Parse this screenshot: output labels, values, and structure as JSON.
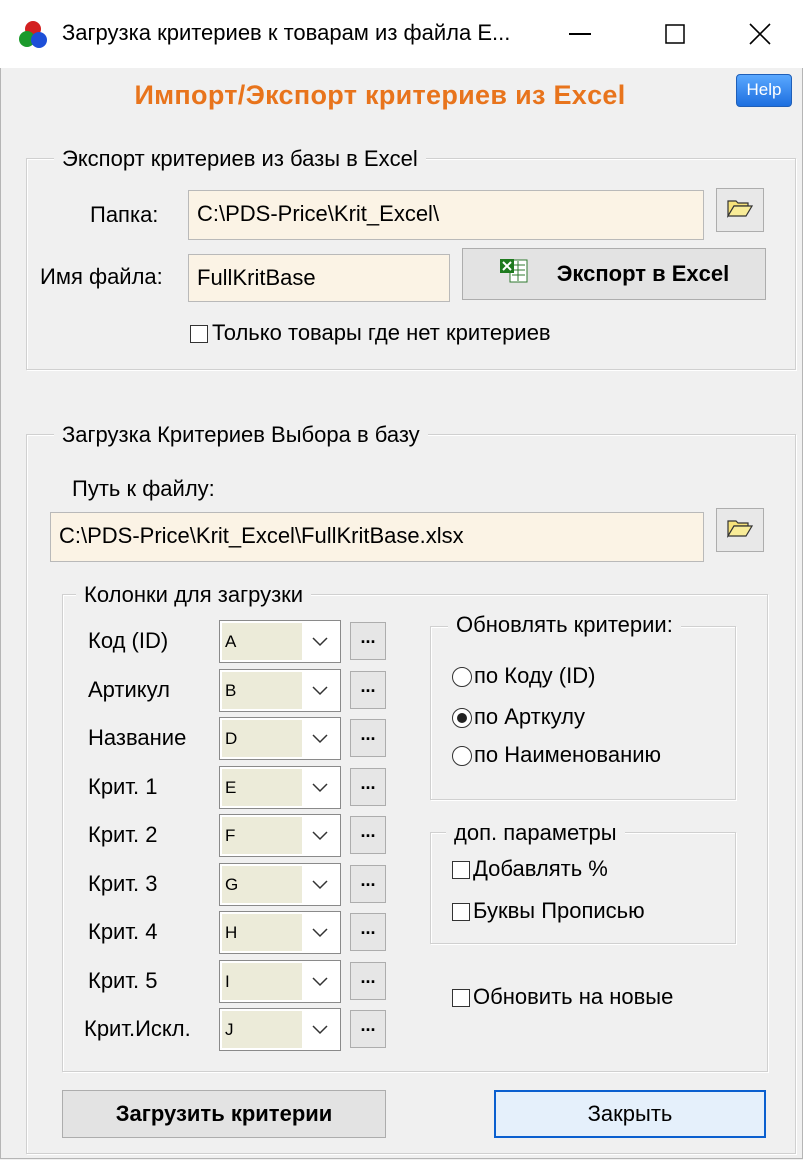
{
  "window": {
    "title": "Загрузка критериев к товарам из файла E...",
    "minimize_glyph": "—",
    "maximize_glyph": "☐",
    "close_glyph": "✕"
  },
  "header": {
    "title": "Импорт/Экспорт критериев из Excel",
    "title_color": "#e8741c",
    "help_label": "Help"
  },
  "export_group": {
    "legend": "Экспорт критериев из базы в Excel",
    "folder_label": "Папка:",
    "folder_value": "C:\\PDS-Price\\Krit_Excel\\",
    "filename_label": "Имя файла:",
    "filename_value": "FullKritBase",
    "export_button": "Экспорт в Excel",
    "only_no_criteria_label": "Только товары где нет критериев",
    "only_no_criteria_checked": false
  },
  "import_group": {
    "legend": "Загрузка Критериев Выбора в базу",
    "path_label": "Путь к файлу:",
    "path_value": "C:\\PDS-Price\\Krit_Excel\\FullKritBase.xlsx"
  },
  "columns_group": {
    "legend": "Колонки для загрузки",
    "rows": [
      {
        "label": "Код (ID)",
        "value": "A"
      },
      {
        "label": "Артикул",
        "value": "B"
      },
      {
        "label": "Название",
        "value": "D"
      },
      {
        "label": "Крит. 1",
        "value": "E"
      },
      {
        "label": "Крит. 2",
        "value": "F"
      },
      {
        "label": "Крит. 3",
        "value": "G"
      },
      {
        "label": "Крит. 4",
        "value": "H"
      },
      {
        "label": "Крит. 5",
        "value": "I"
      },
      {
        "label": "Крит.Искл.",
        "value": "J"
      }
    ],
    "dots_label": "..."
  },
  "update_group": {
    "legend": "Обновлять критерии:",
    "options": [
      {
        "label": "по Коду (ID)",
        "selected": false
      },
      {
        "label": "по Арткулу",
        "selected": true
      },
      {
        "label": "по Наименованию",
        "selected": false
      }
    ]
  },
  "extra_group": {
    "legend": "доп. параметры",
    "add_percent_label": "Добавлять %",
    "add_percent_checked": false,
    "uppercase_label": "Буквы Прописью",
    "uppercase_checked": false
  },
  "update_new_label": "Обновить на новые",
  "update_new_checked": false,
  "footer": {
    "load_button": "Загрузить критерии",
    "close_button": "Закрыть"
  }
}
